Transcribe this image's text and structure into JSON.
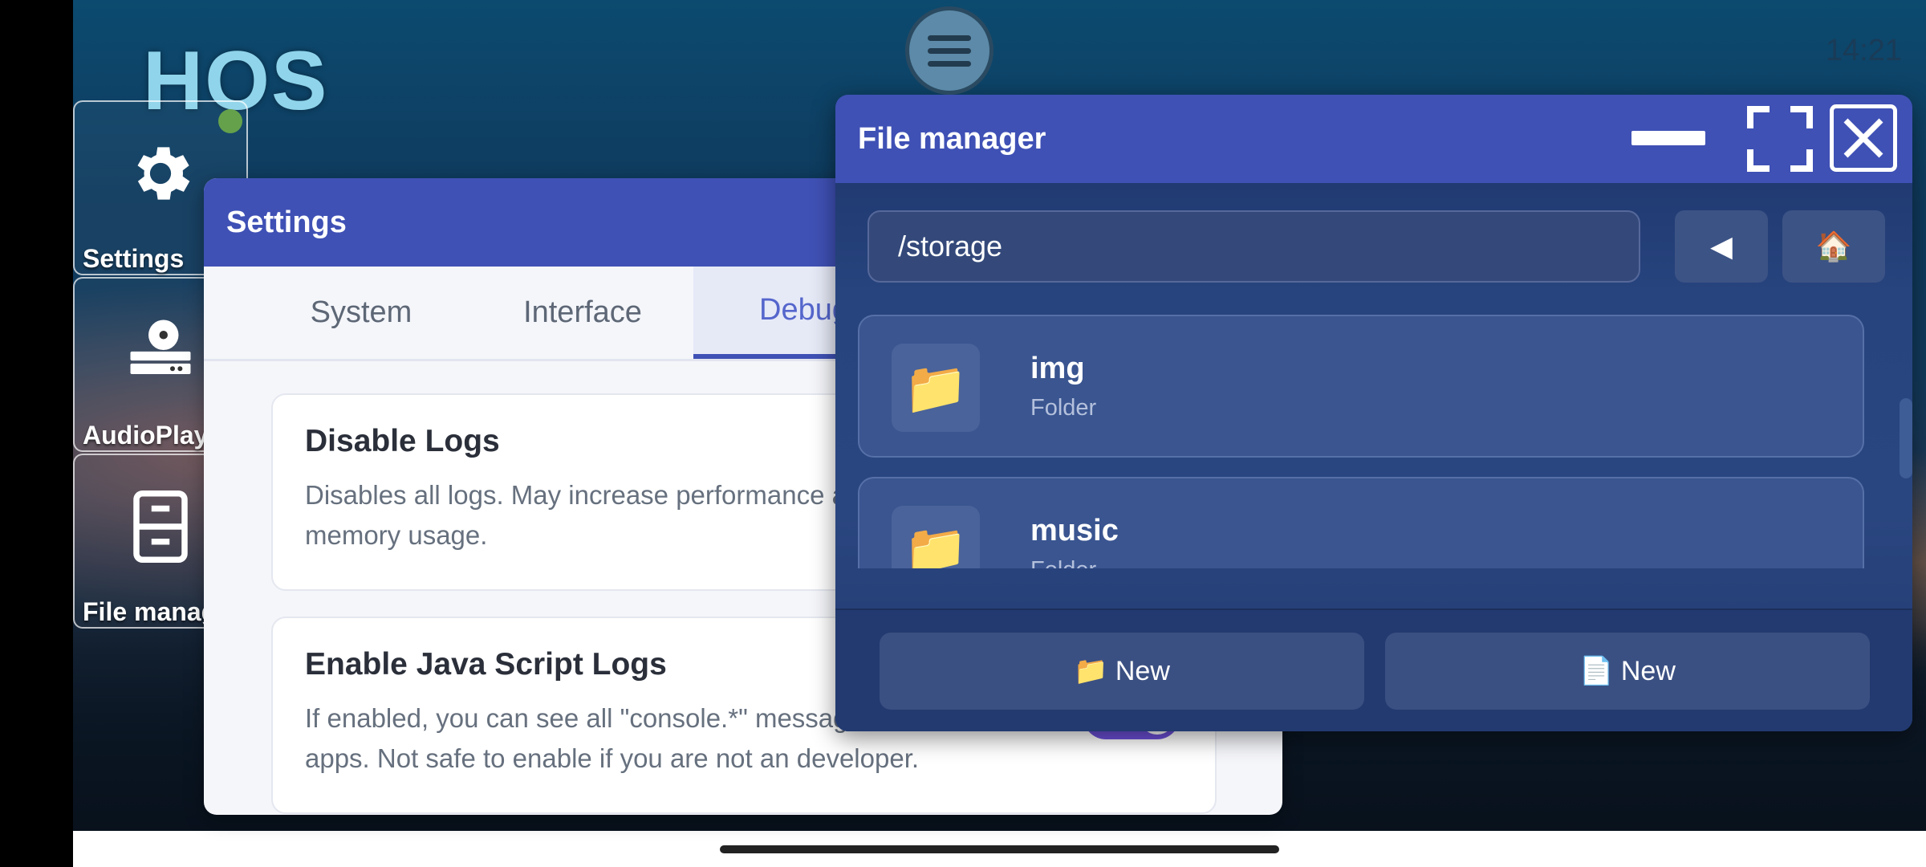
{
  "status": {
    "clock": "14:21"
  },
  "desktop": {
    "logo": "HOS",
    "icons": [
      {
        "label": "Settings",
        "icon": "gear-icon"
      },
      {
        "label": "AudioPlayer",
        "icon": "disc-player-icon"
      },
      {
        "label": "File manager",
        "icon": "cabinet-icon"
      }
    ]
  },
  "settings_window": {
    "title": "Settings",
    "tabs": [
      "System",
      "Interface",
      "Debug"
    ],
    "active_tab": "Debug",
    "cards": [
      {
        "title": "Disable Logs",
        "description": "Disables all logs. May increase performance and reduce memory usage.",
        "enabled": false
      },
      {
        "title": "Enable Java Script Logs",
        "description": "If enabled, you can see all \"console.*\" messages from apps. Not safe to enable if you are not an developer.",
        "enabled": true
      }
    ]
  },
  "file_manager": {
    "title": "File manager",
    "path": "/storage",
    "back_glyph": "◀",
    "home_glyph": "🏠",
    "items": [
      {
        "name": "img",
        "type": "Folder",
        "icon": "📁"
      },
      {
        "name": "music",
        "type": "Folder",
        "icon": "📁"
      }
    ],
    "new_folder_label": "📁 New",
    "new_file_label": "📄 New"
  },
  "colors": {
    "accent": "#3f51b5",
    "toggle_on": "#6c4fd8",
    "fm_body": "#223a73"
  }
}
